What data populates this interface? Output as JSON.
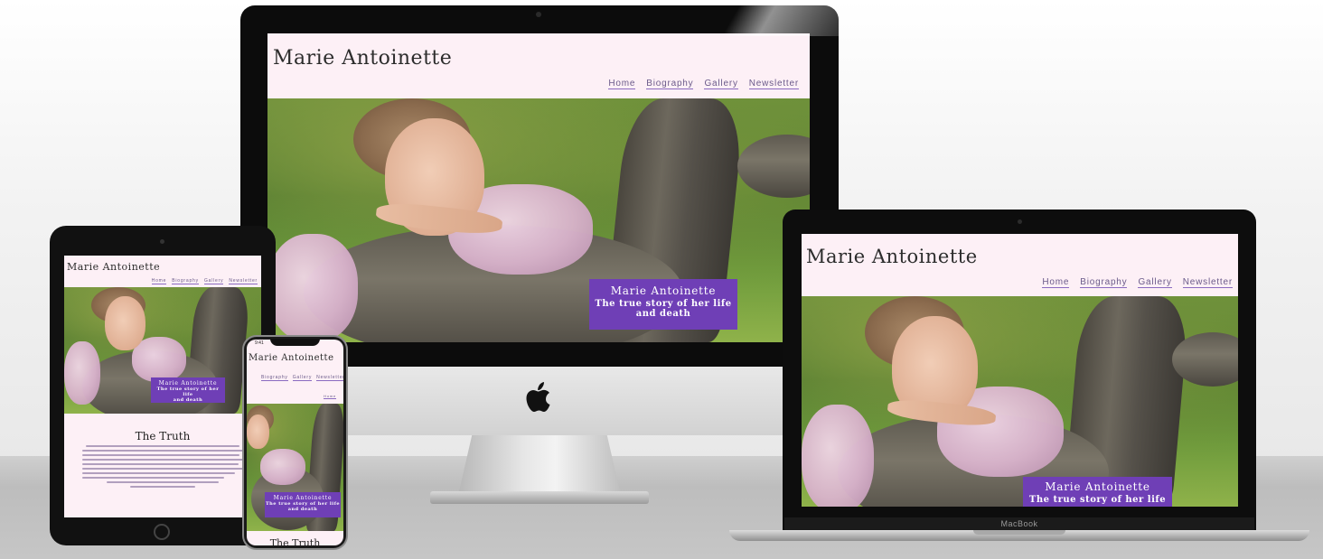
{
  "site": {
    "title": "Marie Antoinette",
    "nav": [
      "Home",
      "Biography",
      "Gallery",
      "Newsletter"
    ],
    "hero_title": "Marie Antoinette",
    "hero_subtitle_line1": "The true story of her life",
    "hero_subtitle_line2": "and death",
    "section_heading": "The Truth"
  },
  "devices": {
    "laptop_label": "MacBook",
    "apple_logo": "",
    "phone_time": "9:41"
  },
  "colors": {
    "page_bg": "#fdf0f6",
    "badge": "#6f3fb6",
    "nav_underline": "#8a6ac0"
  }
}
